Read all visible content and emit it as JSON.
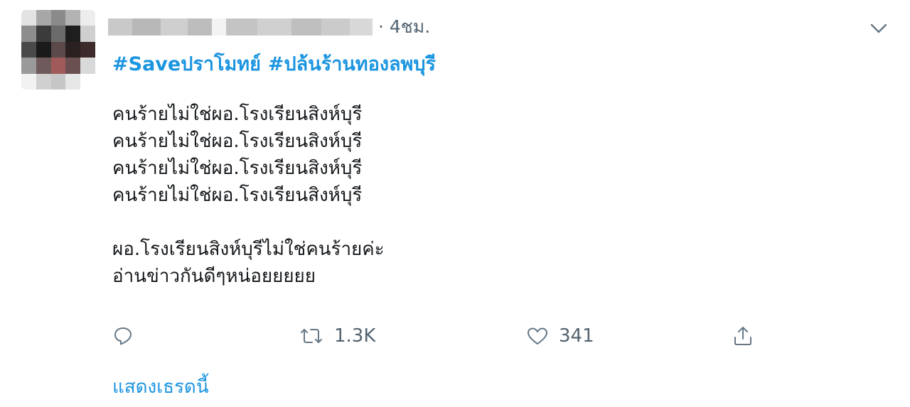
{
  "tweet": {
    "time": "· 4ชม.",
    "hashtags": [
      "#Saveปราโมทย์",
      "#ปล้นร้านทองลพบุรี"
    ],
    "lines": [
      "คนร้ายไม่ใช่ผอ.โรงเรียนสิงห์บุรี",
      "คนร้ายไม่ใช่ผอ.โรงเรียนสิงห์บุรี",
      "คนร้ายไม่ใช่ผอ.โรงเรียนสิงห์บุรี",
      "คนร้ายไม่ใช่ผอ.โรงเรียนสิงห์บุรี"
    ],
    "lines2": [
      "ผอ.โรงเรียนสิงห์บุรีไม่ใช่คนร้ายค่ะ",
      "อ่านข่าวกันดีๆหน่อยยยยย"
    ],
    "actions": {
      "reply_icon": "reply-icon",
      "retweet_icon": "retweet-icon",
      "retweet_count": "1.3K",
      "like_icon": "heart-icon",
      "like_count": "341",
      "share_icon": "share-icon"
    },
    "show_thread": "แสดงเธรดนี้"
  },
  "colors": {
    "link": "#1b95e0",
    "muted": "#536471",
    "text": "#14171a"
  }
}
